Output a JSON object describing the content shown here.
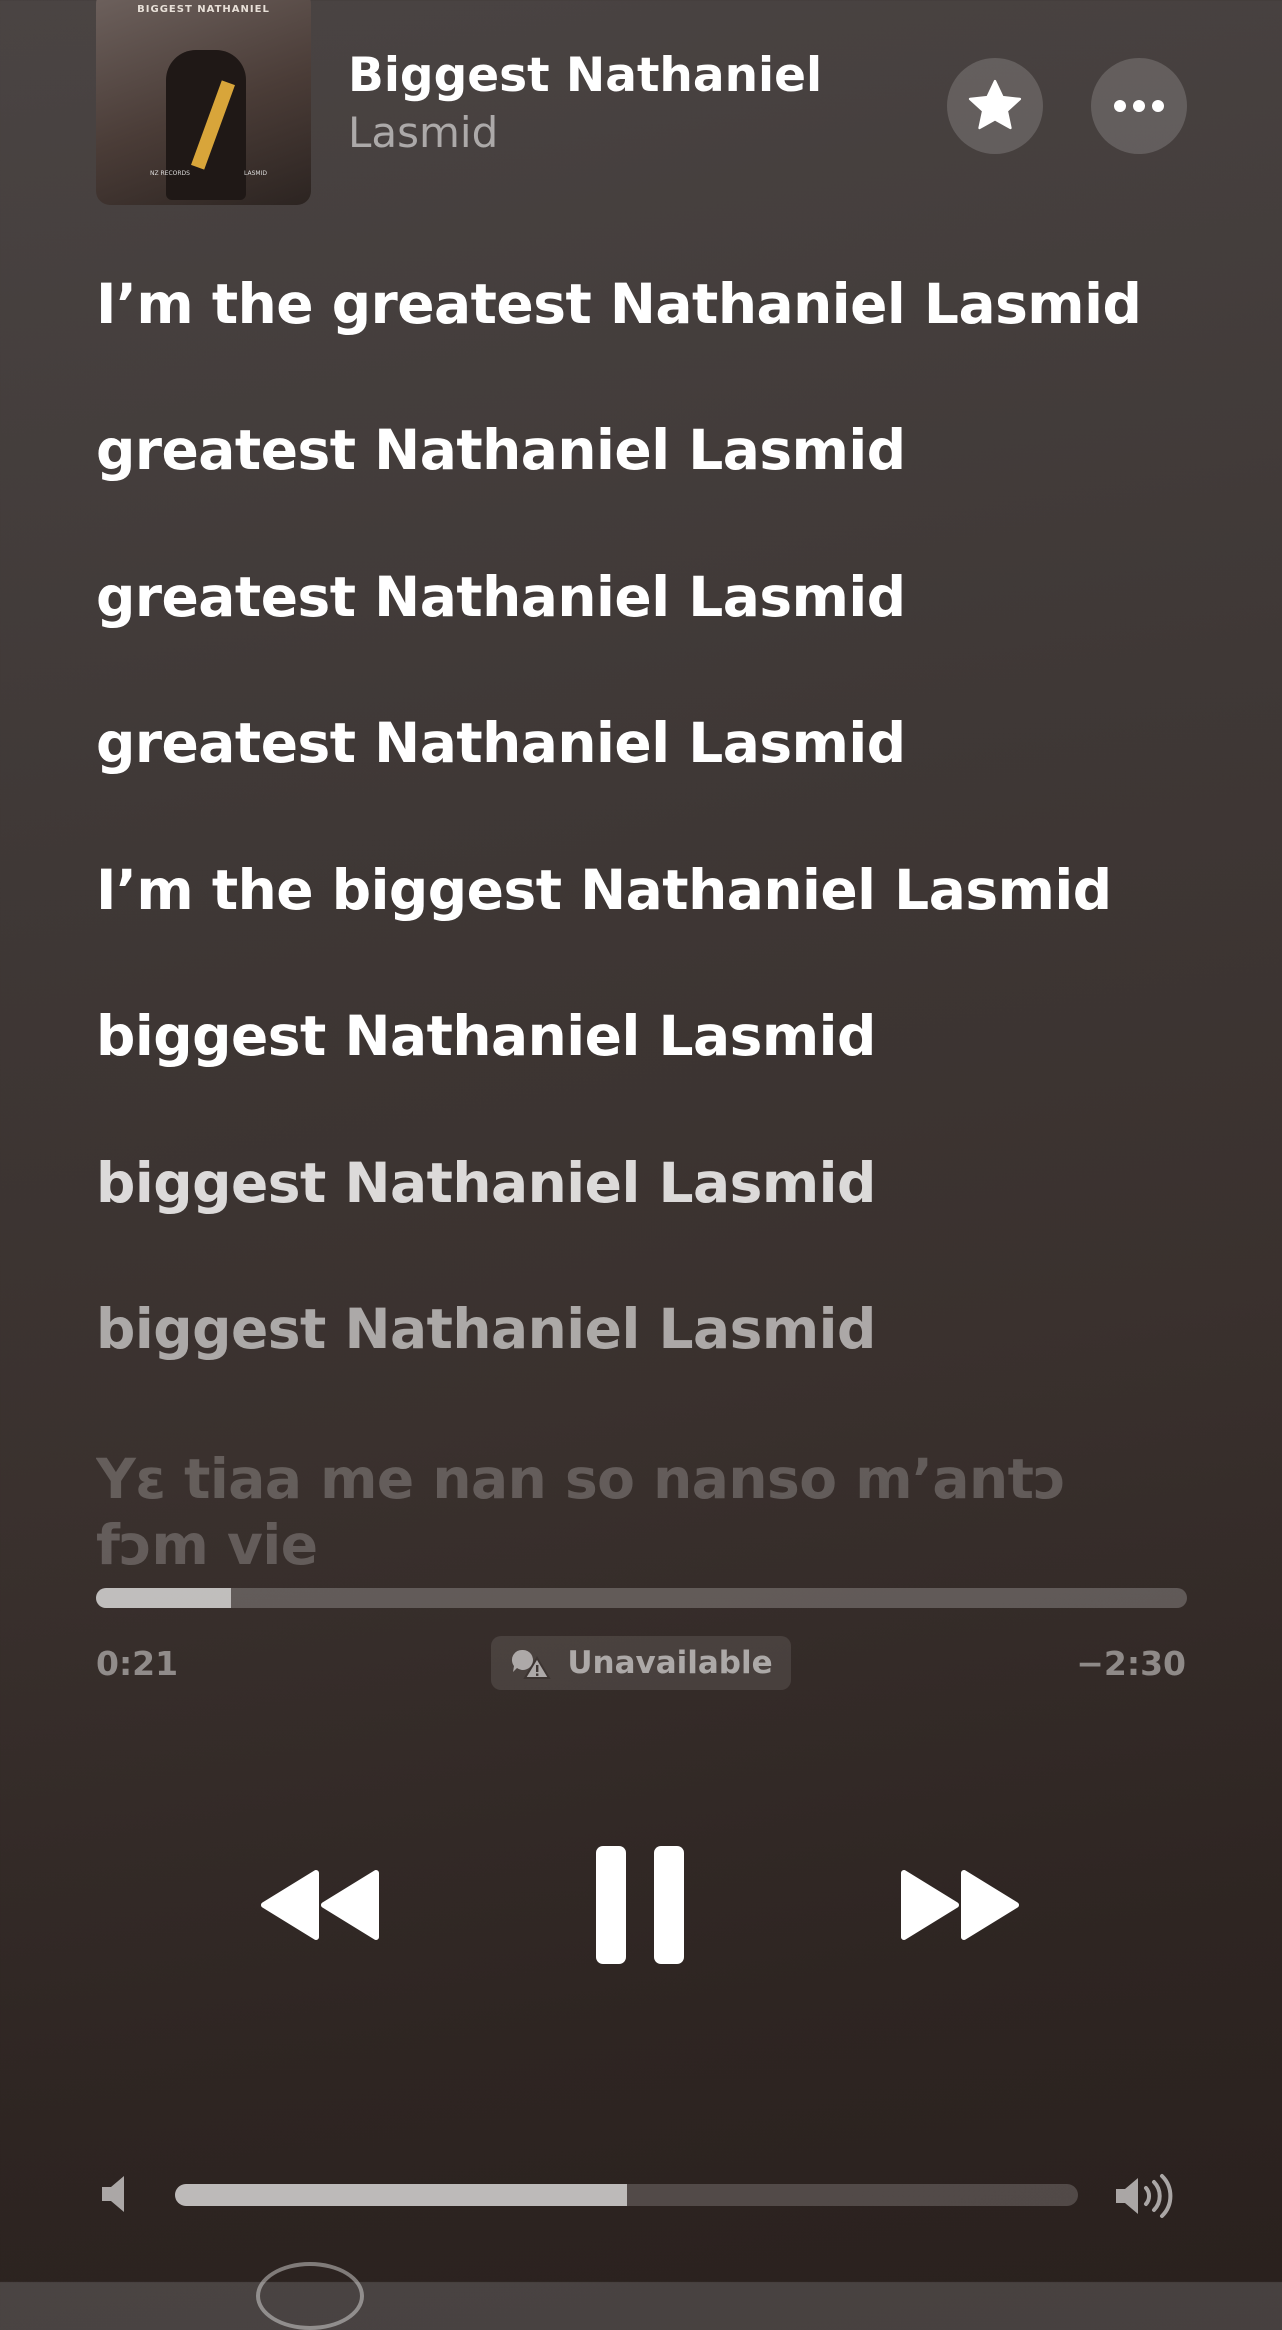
{
  "now_playing": {
    "title": "Biggest Nathaniel",
    "artist": "Lasmid",
    "artwork": {
      "caption": "BIGGEST NATHANIEL",
      "label_left": "NZ RECORDS",
      "label_right": "LASMID"
    },
    "favorite_icon": "star-icon",
    "more_icon": "ellipsis-icon"
  },
  "lyrics": [
    {
      "text": "I’m the greatest Nathaniel Lasmid"
    },
    {
      "text": "greatest Nathaniel Lasmid"
    },
    {
      "text": "greatest Nathaniel Lasmid"
    },
    {
      "text": "greatest Nathaniel Lasmid"
    },
    {
      "text": "I’m the biggest Nathaniel Lasmid"
    },
    {
      "text": "biggest Nathaniel Lasmid"
    },
    {
      "text": "biggest Nathaniel Lasmid"
    },
    {
      "text": "biggest Nathaniel Lasmid"
    },
    {
      "text": "Yɛ tiaa me nan so nanso m’antɔ fɔm vie"
    }
  ],
  "playback": {
    "elapsed": "0:21",
    "remaining": "−2:30",
    "progress_fraction": 0.124,
    "status_label": "Unavailable",
    "status_icon": "lyrics-unavailable-icon"
  },
  "controls": {
    "previous_icon": "rewind-icon",
    "play_pause_icon": "pause-icon",
    "next_icon": "fast-forward-icon"
  },
  "volume": {
    "level_fraction": 0.5,
    "low_icon": "speaker-low-icon",
    "high_icon": "speaker-high-icon"
  },
  "colors": {
    "background_top": "#4a4443",
    "background_bottom": "#2a211e",
    "text_primary": "#ffffff"
  }
}
